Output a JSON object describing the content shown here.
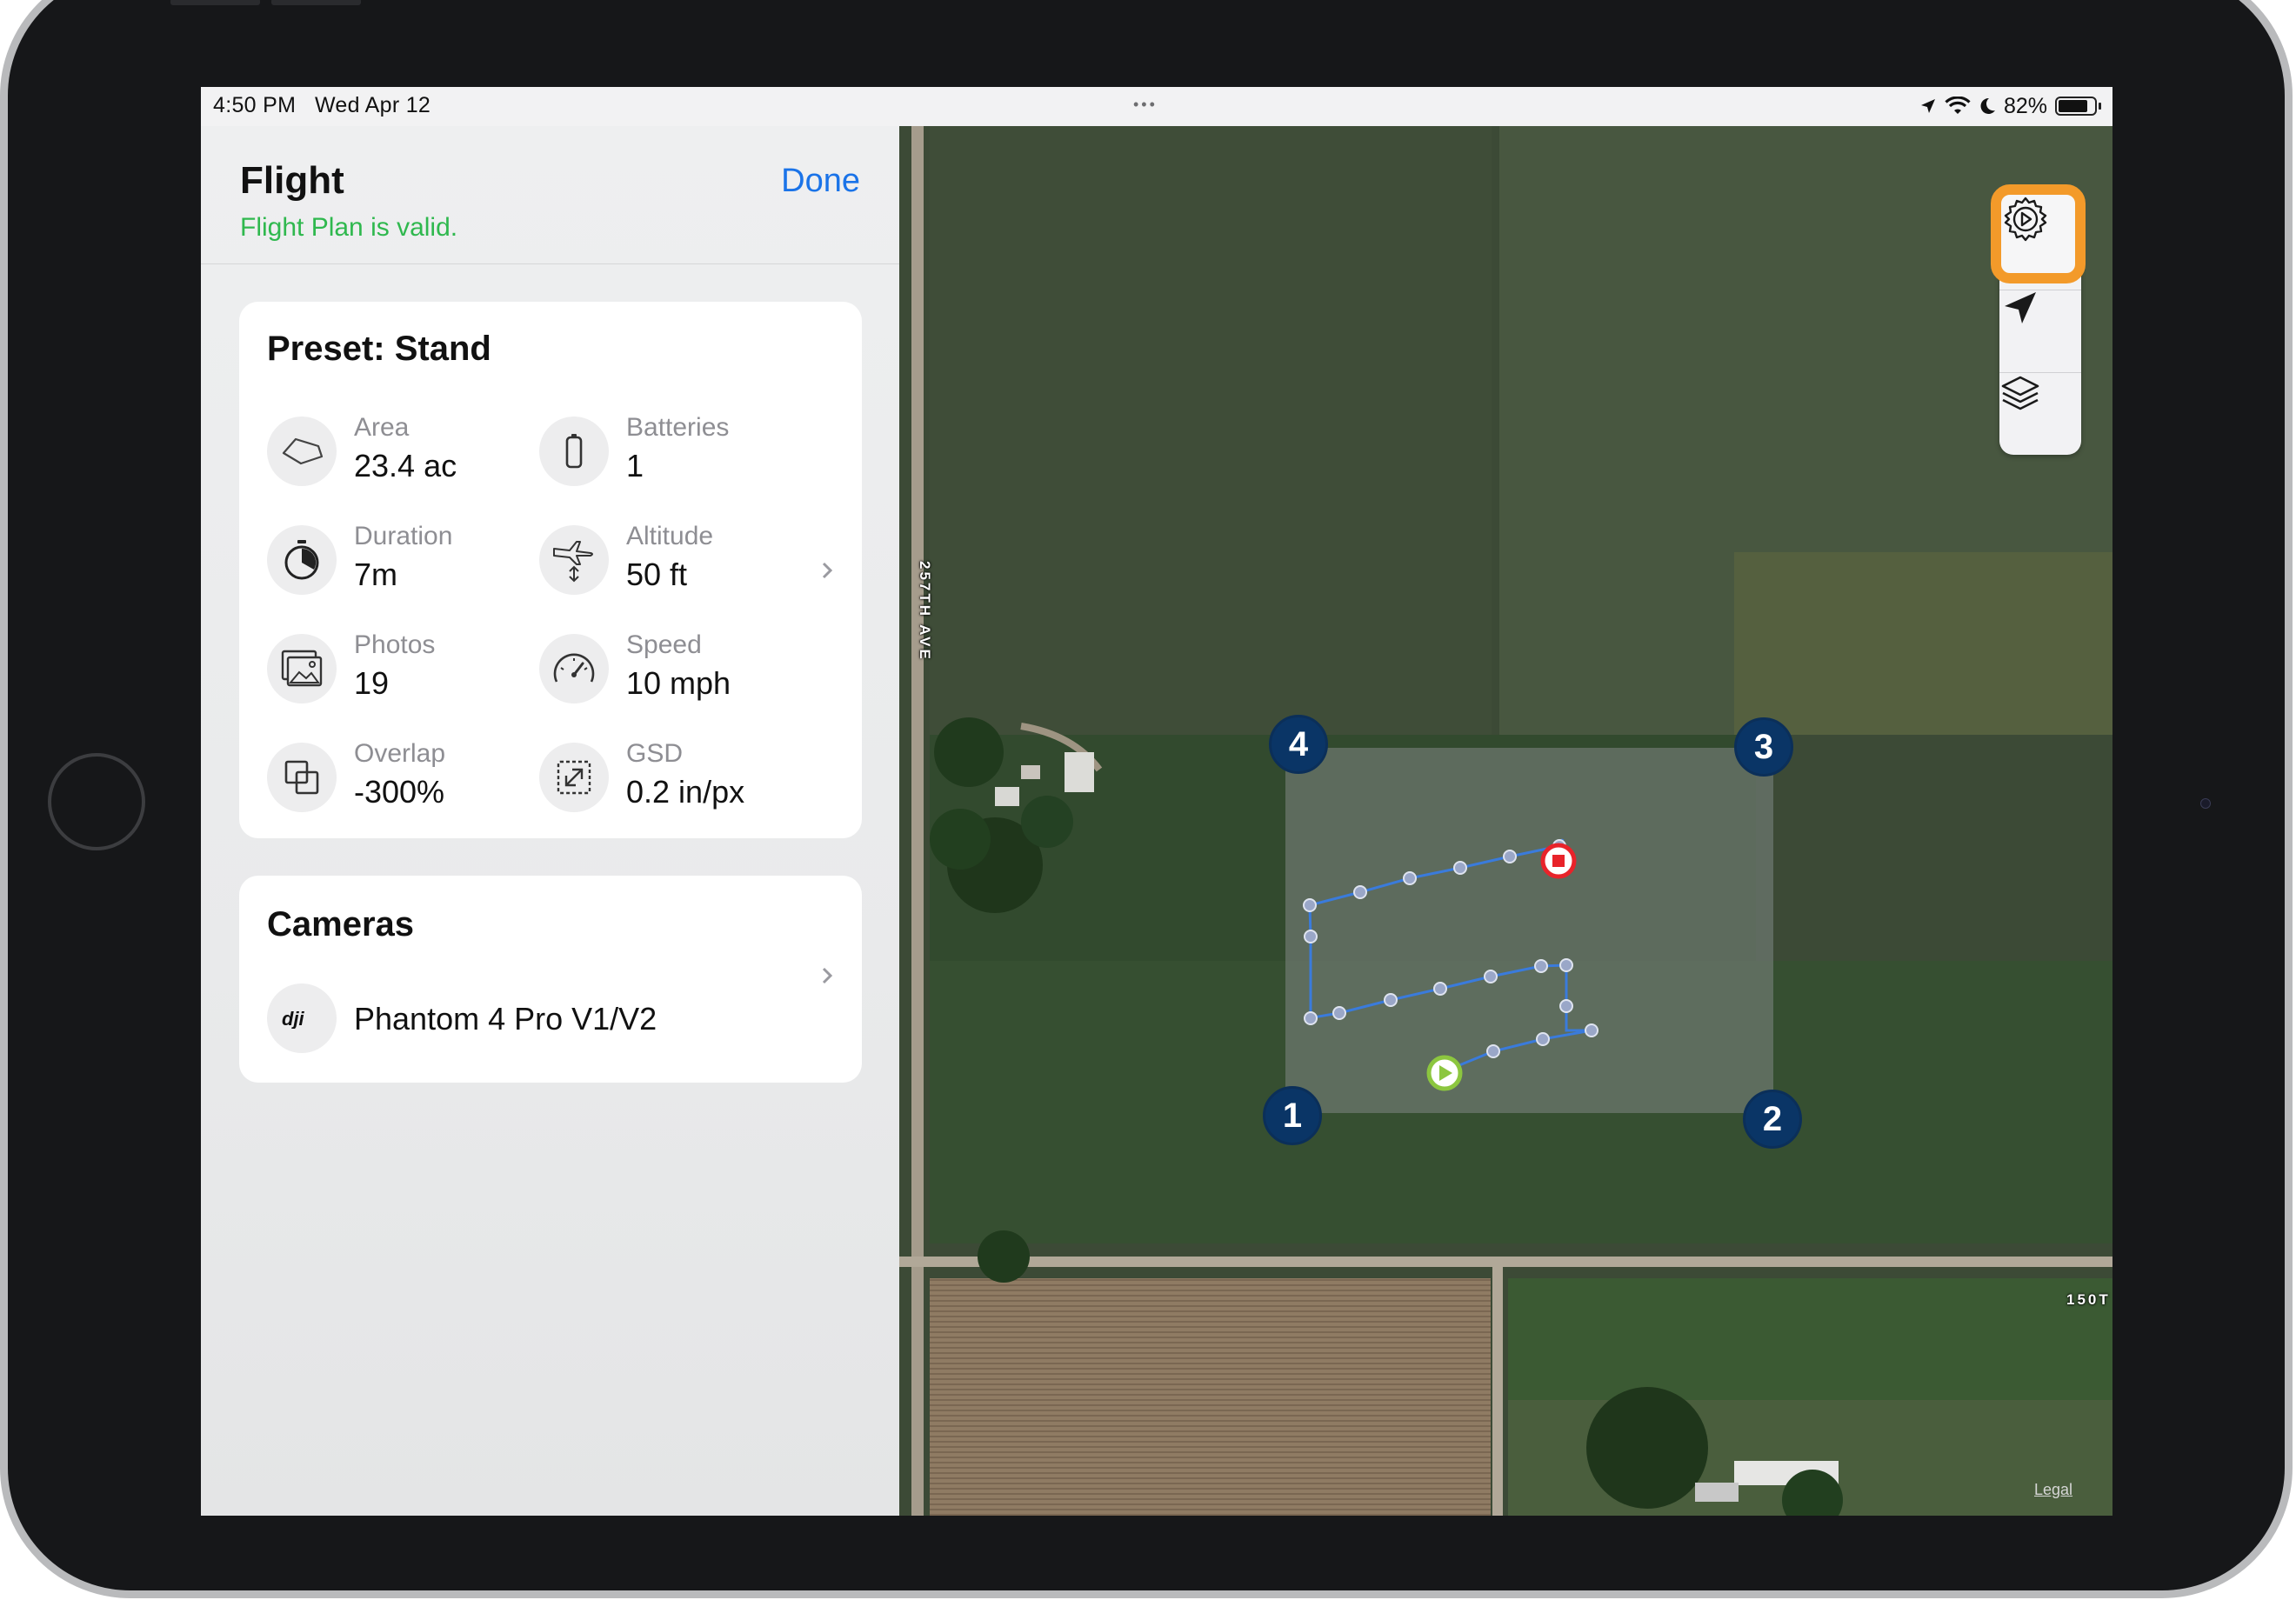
{
  "status_bar": {
    "time": "4:50 PM",
    "date": "Wed Apr 12",
    "multitask_dots": "•••",
    "battery_percent": "82%",
    "battery_level": 0.82
  },
  "panel": {
    "title": "Flight",
    "validation": "Flight Plan is valid.",
    "done_label": "Done"
  },
  "preset_card": {
    "title": "Preset: Stand",
    "stats": [
      {
        "label": "Area",
        "value": "23.4 ac",
        "icon": "area-polygon-icon"
      },
      {
        "label": "Batteries",
        "value": "1",
        "icon": "battery-icon"
      },
      {
        "label": "Duration",
        "value": "7m",
        "icon": "timer-icon"
      },
      {
        "label": "Altitude",
        "value": "50 ft",
        "icon": "altitude-plane-icon"
      },
      {
        "label": "Photos",
        "value": "19",
        "icon": "photos-icon"
      },
      {
        "label": "Speed",
        "value": "10 mph",
        "icon": "speedometer-icon"
      },
      {
        "label": "Overlap",
        "value": "-300%",
        "icon": "overlap-icon"
      },
      {
        "label": "GSD",
        "value": "0.2 in/px",
        "icon": "gsd-icon"
      }
    ]
  },
  "cameras_card": {
    "title": "Cameras",
    "camera_name": "Phantom 4 Pro V1/V2",
    "camera_brand_icon": "dji-logo-icon"
  },
  "map": {
    "road_vertical": "257TH AVE",
    "road_horizontal": "150T",
    "legal_label": "Legal",
    "corner_markers": [
      "1",
      "2",
      "3",
      "4"
    ],
    "tools": [
      "settings-icon",
      "location-arrow-icon",
      "layers-icon"
    ]
  },
  "colors": {
    "accent": "#1a73e8",
    "valid_green": "#2fb84e",
    "highlight_orange": "#f39a2a",
    "marker_blue": "#0a3566",
    "path_blue": "#3a7bdc",
    "start_green": "#8cc63f",
    "end_red": "#e8232a"
  }
}
